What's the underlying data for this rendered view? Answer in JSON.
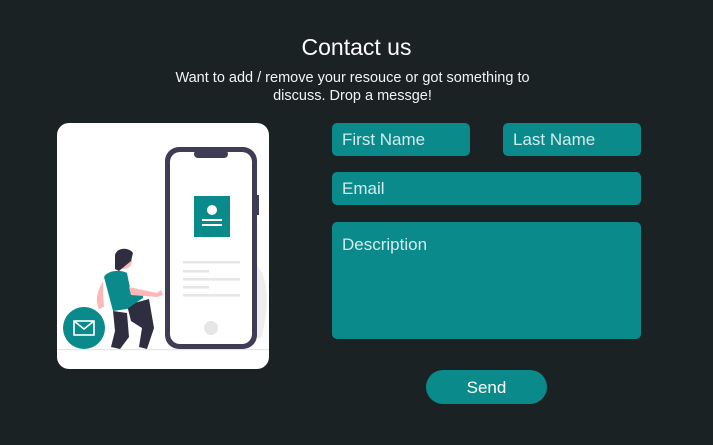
{
  "header": {
    "title": "Contact us",
    "subtitle": "Want to add / remove your resouce or got something to discuss. Drop a messge!"
  },
  "form": {
    "first_name_placeholder": "First Name",
    "last_name_placeholder": "Last Name",
    "email_placeholder": "Email",
    "description_placeholder": "Description",
    "send_label": "Send"
  },
  "colors": {
    "background": "#1b2224",
    "accent": "#0a8a8a",
    "card": "#ffffff",
    "phone_frame": "#3f3d56"
  },
  "icons": [
    "envelope-icon",
    "contact-card-icon"
  ]
}
